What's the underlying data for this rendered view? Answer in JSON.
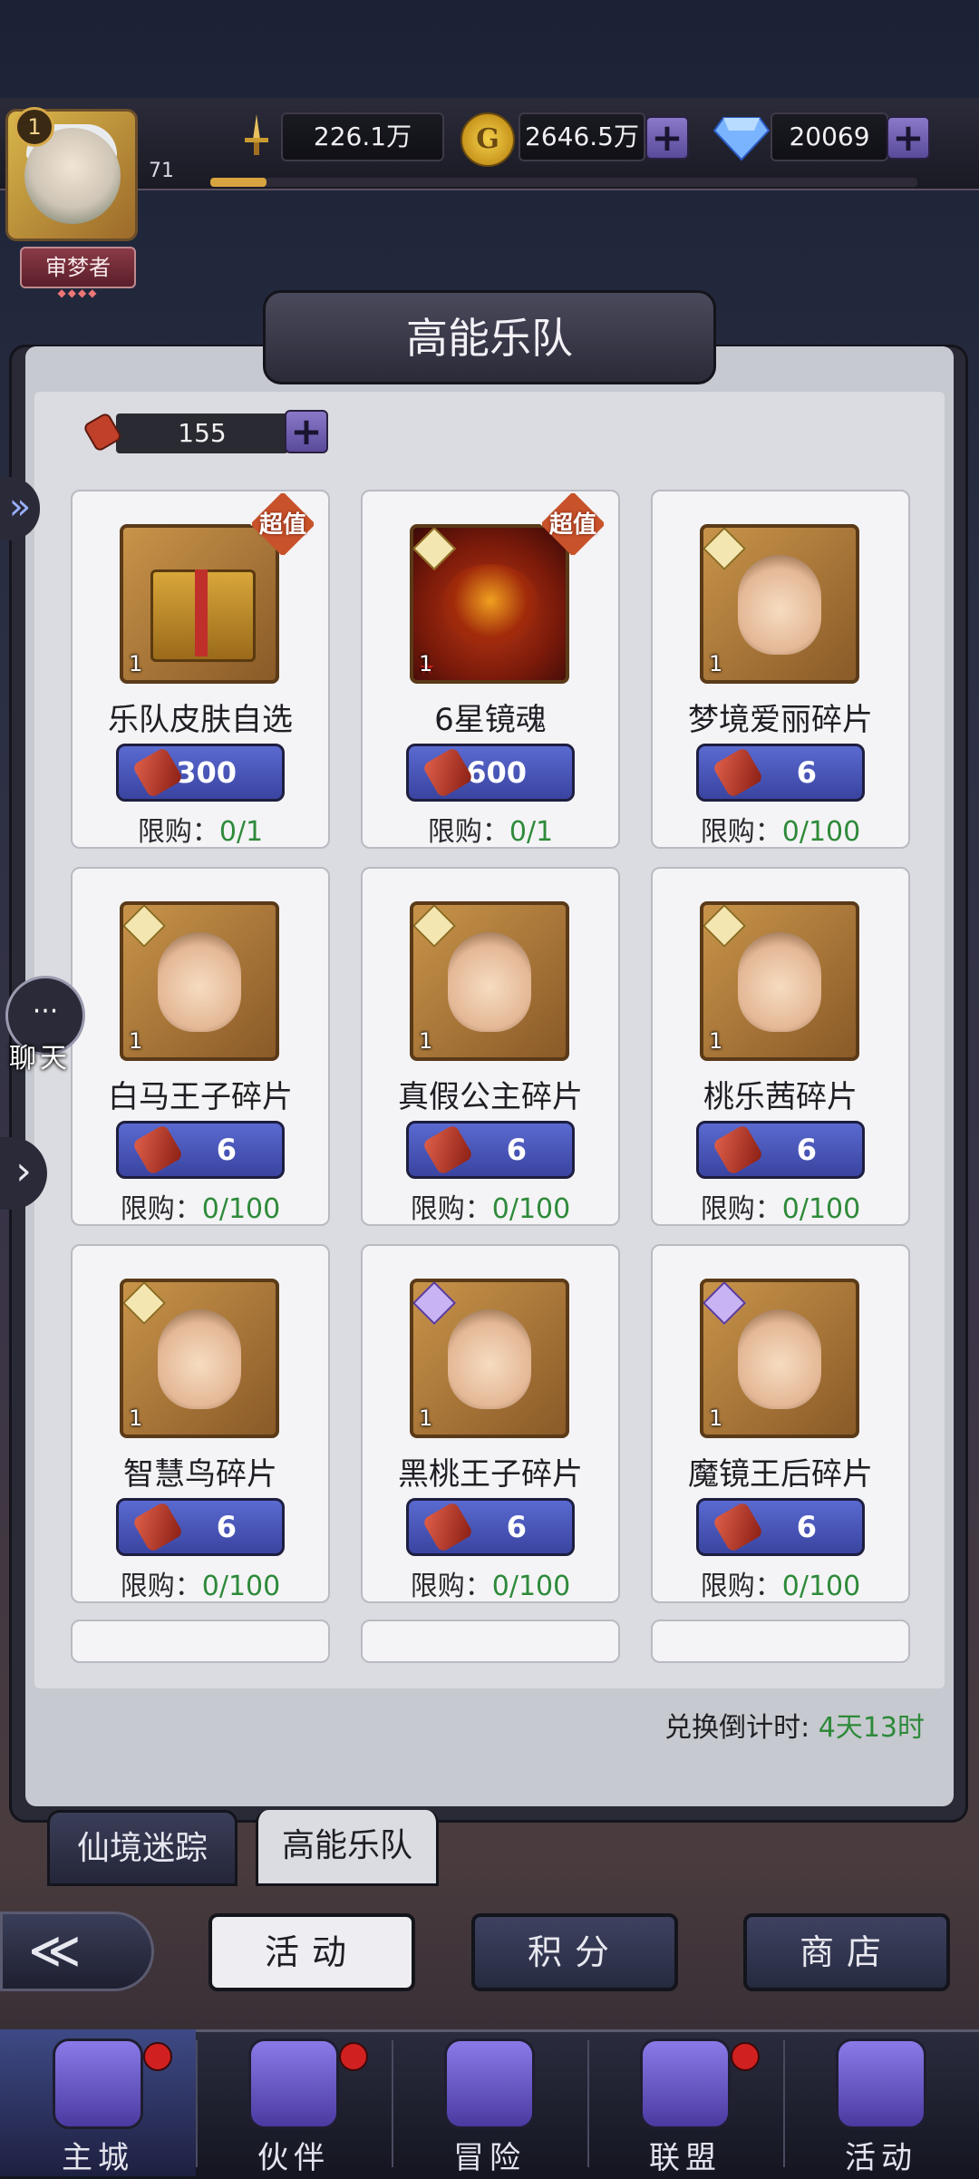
{
  "player": {
    "level": "1",
    "title": "审梦者",
    "exp_level": "71",
    "exp_progress": 0.08
  },
  "resources": {
    "power": "226.1万",
    "gold": "2646.5万",
    "gems": "20069",
    "plus": "+"
  },
  "panel": {
    "title": "高能乐队",
    "scroll_count": "155"
  },
  "items": [
    {
      "name": "乐队皮肤自选",
      "qty": "1",
      "price": "300",
      "limit_label": "限购：",
      "limit": "0/1",
      "tag": "超值",
      "art": "gift-box"
    },
    {
      "name": "6星镜魂",
      "qty": "1",
      "price": "600",
      "limit_label": "限购：",
      "limit": "0/1",
      "tag": "超值",
      "art": "mirror-soul"
    },
    {
      "name": "梦境爱丽碎片",
      "qty": "1",
      "price": "6",
      "limit_label": "限购：",
      "limit": "0/100",
      "art": "hero-fragment"
    },
    {
      "name": "白马王子碎片",
      "qty": "1",
      "price": "6",
      "limit_label": "限购：",
      "limit": "0/100",
      "art": "hero-fragment"
    },
    {
      "name": "真假公主碎片",
      "qty": "1",
      "price": "6",
      "limit_label": "限购：",
      "limit": "0/100",
      "art": "hero-fragment"
    },
    {
      "name": "桃乐茜碎片",
      "qty": "1",
      "price": "6",
      "limit_label": "限购：",
      "limit": "0/100",
      "art": "hero-fragment"
    },
    {
      "name": "智慧鸟碎片",
      "qty": "1",
      "price": "6",
      "limit_label": "限购：",
      "limit": "0/100",
      "art": "hero-fragment"
    },
    {
      "name": "黑桃王子碎片",
      "qty": "1",
      "price": "6",
      "limit_label": "限购：",
      "limit": "0/100",
      "art": "hero-fragment"
    },
    {
      "name": "魔镜王后碎片",
      "qty": "1",
      "price": "6",
      "limit_label": "限购：",
      "limit": "0/100",
      "art": "hero-fragment"
    }
  ],
  "countdown": {
    "label": "兑换倒计时: ",
    "value": "4天13时"
  },
  "tabs": {
    "tab1": "仙境迷踪",
    "tab2": "高能乐队"
  },
  "buttons": {
    "activity": "活动",
    "points": "积分",
    "shop": "商店"
  },
  "side": {
    "chat": "聊天"
  },
  "nav": [
    {
      "label": "主城",
      "badge": true
    },
    {
      "label": "伙伴",
      "badge": true
    },
    {
      "label": "冒险",
      "badge": false
    },
    {
      "label": "联盟",
      "badge": true
    },
    {
      "label": "活动",
      "badge": false
    }
  ],
  "colors": {
    "limit_value": "#2e8a3a",
    "price_button": "#4a56c0",
    "badge_red": "#d02020"
  }
}
